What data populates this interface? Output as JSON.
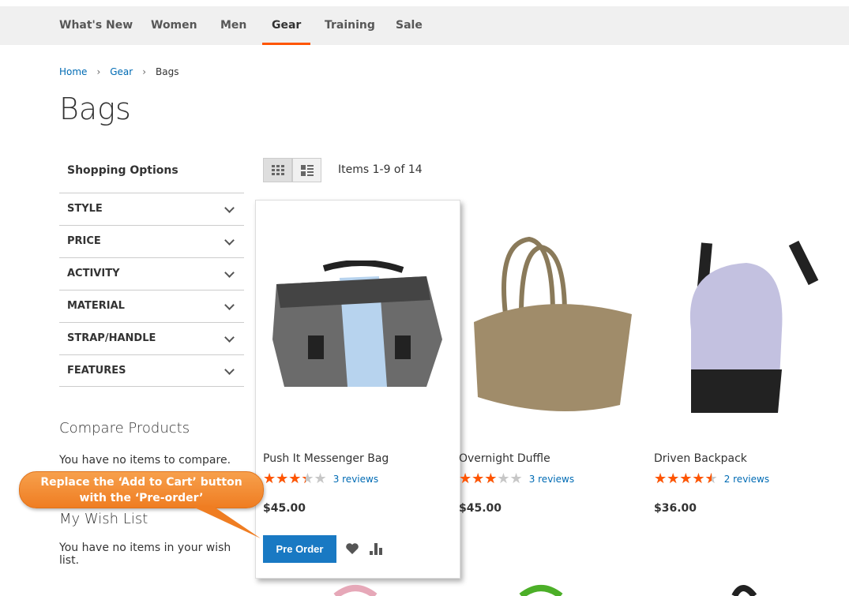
{
  "nav": {
    "items": [
      "What's New",
      "Women",
      "Men",
      "Gear",
      "Training",
      "Sale"
    ],
    "active": "Gear"
  },
  "breadcrumb": [
    "Home",
    "Gear",
    "Bags"
  ],
  "page_title": "Bags",
  "sidebar": {
    "title": "Shopping Options",
    "filters": [
      "STYLE",
      "PRICE",
      "ACTIVITY",
      "MATERIAL",
      "STRAP/HANDLE",
      "FEATURES"
    ],
    "compare_title": "Compare Products",
    "compare_text": "You have no items to compare.",
    "wishlist_title": "My Wish List",
    "wishlist_text": "You have no items in your wish list."
  },
  "toolbar": {
    "items_count": "Items 1-9 of 14",
    "view_mode": "grid"
  },
  "products": [
    {
      "name": "Push It Messenger Bag",
      "rating_percent": 67,
      "reviews": "3 reviews",
      "price": "$45.00"
    },
    {
      "name": "Overnight Duffle",
      "rating_percent": 60,
      "reviews": "3 reviews",
      "price": "$45.00"
    },
    {
      "name": "Driven Backpack",
      "rating_percent": 90,
      "reviews": "2 reviews",
      "price": "$36.00"
    }
  ],
  "card_actions": {
    "pre_order_label": "Pre Order",
    "wishlist_icon": "heart-icon",
    "compare_icon": "bar-chart-icon"
  },
  "callout": {
    "line1": "Replace the ‘Add to Cart’ button",
    "line2": "with the ‘Pre-order’"
  },
  "colors": {
    "accent": "#ff5501",
    "button": "#1979c3",
    "link": "#006bb4",
    "callout": "#ef7d22"
  }
}
